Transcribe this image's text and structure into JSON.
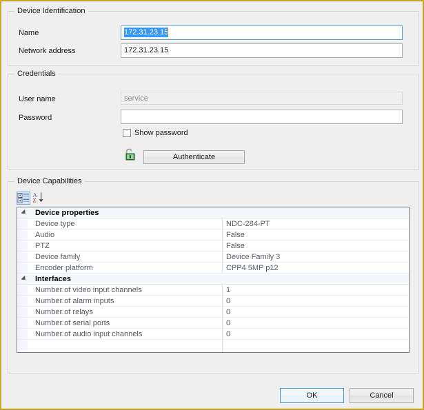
{
  "window": {
    "accent_border": "#c9a227",
    "background": "#efefef"
  },
  "device_identification": {
    "title": "Device Identification",
    "name_label": "Name",
    "name_value": "172.31.23.15",
    "name_selected": true,
    "network_address_label": "Network address",
    "network_address_value": "172.31.23.15",
    "selection_color": "#3399ff"
  },
  "credentials": {
    "title": "Credentials",
    "user_name_label": "User name",
    "user_name_value": "service",
    "user_name_disabled": true,
    "password_label": "Password",
    "password_value": "",
    "show_password_label": "Show password",
    "show_password_checked": false,
    "authenticate_label": "Authenticate",
    "lock_icon": "padlock-unlocked-icon",
    "lock_color": "#2e8b2e"
  },
  "device_capabilities": {
    "title": "Device Capabilities",
    "toolbar": {
      "categorized_icon": "categorized-view-icon",
      "categorized_active": true,
      "alphabetical_icon": "alphabetical-sort-icon"
    },
    "groups": [
      {
        "name": "Device properties",
        "expanded": true,
        "rows": [
          {
            "name": "Device type",
            "value": "NDC-284-PT"
          },
          {
            "name": "Audio",
            "value": "False"
          },
          {
            "name": "PTZ",
            "value": "False"
          },
          {
            "name": "Device family",
            "value": "Device Family 3"
          },
          {
            "name": "Encoder platform",
            "value": "CPP4 5MP p12"
          }
        ]
      },
      {
        "name": "Interfaces",
        "expanded": true,
        "rows": [
          {
            "name": "Number of video input channels",
            "value": "1"
          },
          {
            "name": "Number of alarm inputs",
            "value": "0"
          },
          {
            "name": "Number of relays",
            "value": "0"
          },
          {
            "name": "Number of serial ports",
            "value": "0"
          },
          {
            "name": "Number of audio input channels",
            "value": "0"
          }
        ]
      }
    ]
  },
  "footer": {
    "ok_label": "OK",
    "cancel_label": "Cancel",
    "default_button": "ok",
    "default_border_color": "#3c9ade"
  }
}
